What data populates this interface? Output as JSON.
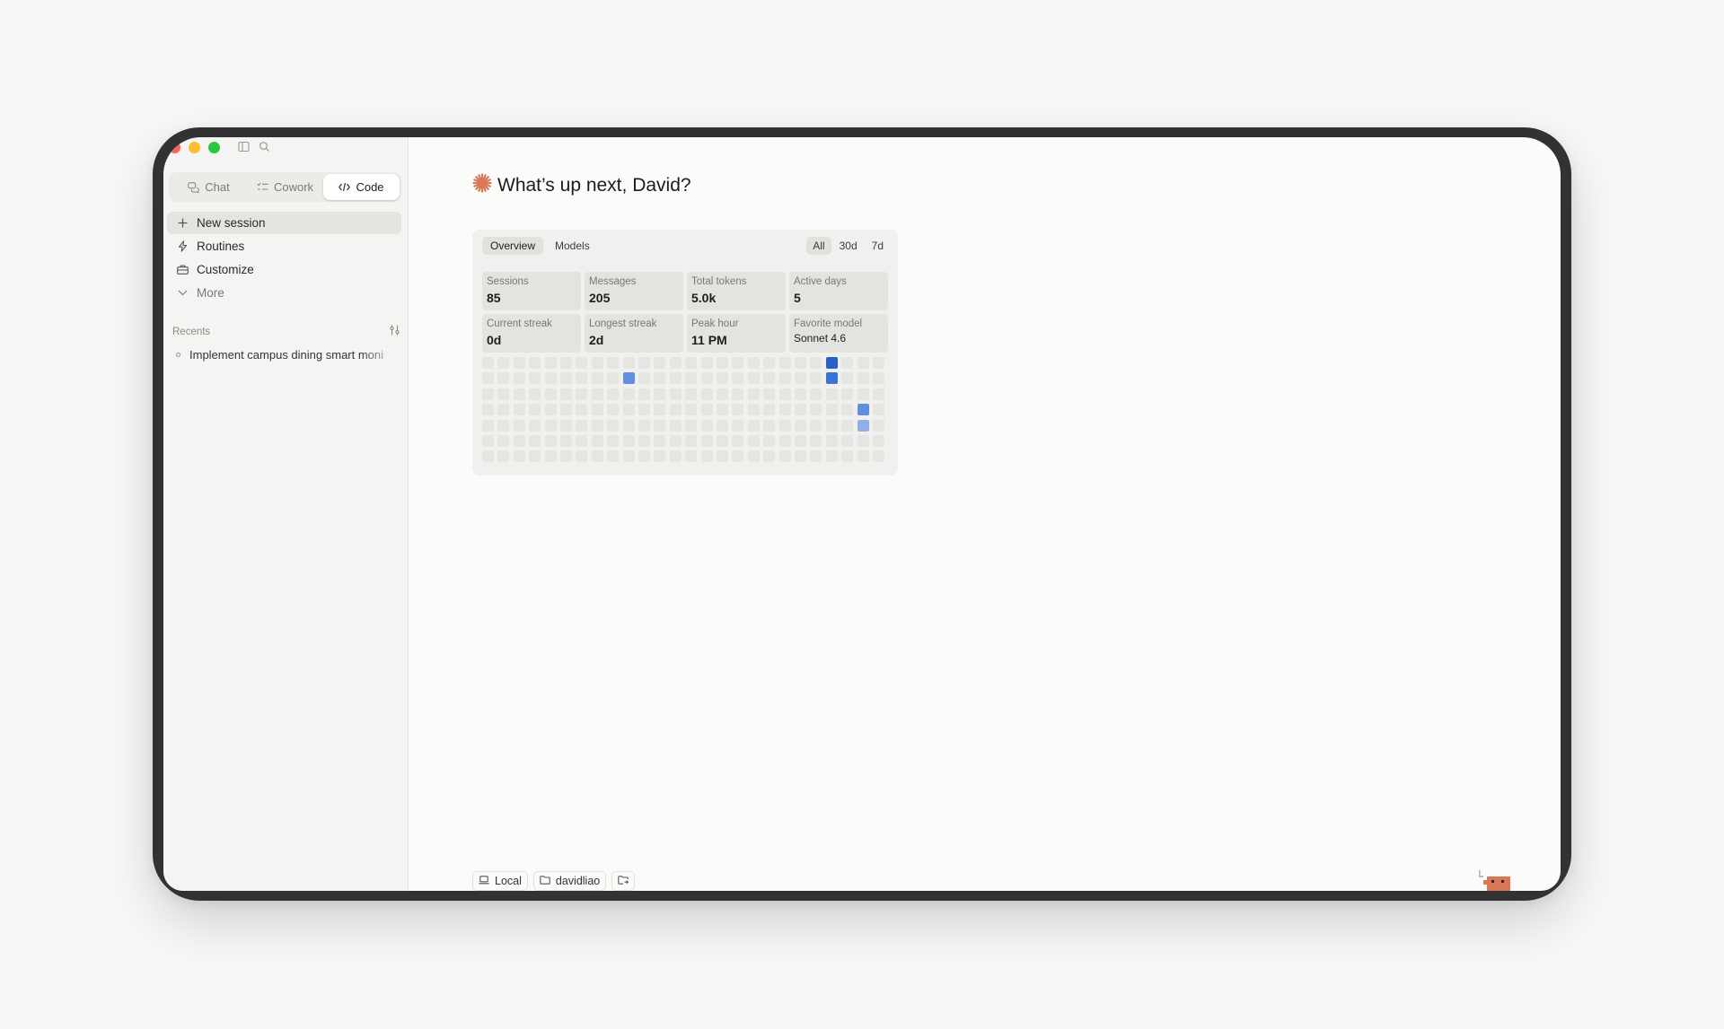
{
  "window": {
    "controls": [
      "close",
      "minimize",
      "maximize"
    ],
    "icons": [
      "sidebar-toggle-icon",
      "search-icon"
    ]
  },
  "sidebar": {
    "mode_tabs": [
      {
        "label": "Chat",
        "icon": "chat-bubbles-icon",
        "active": false
      },
      {
        "label": "Cowork",
        "icon": "checklist-icon",
        "active": false
      },
      {
        "label": "Code",
        "icon": "code-brackets-icon",
        "active": true
      }
    ],
    "nav_items": [
      {
        "label": "New session",
        "icon": "plus-icon",
        "active": true
      },
      {
        "label": "Routines",
        "icon": "lightning-icon"
      },
      {
        "label": "Customize",
        "icon": "briefcase-icon"
      },
      {
        "label": "More",
        "icon": "chevron-down-icon"
      }
    ],
    "recents": {
      "heading": "Recents",
      "filter_icon": "sliders-icon",
      "items": [
        {
          "label": "Implement campus dining smart moni"
        }
      ]
    }
  },
  "main": {
    "greeting": "What’s up next, David?",
    "greeting_icon": "sparkle-asterisk-icon",
    "accent_color": "#d97757"
  },
  "stats": {
    "tabs": [
      {
        "label": "Overview",
        "active": true
      },
      {
        "label": "Models",
        "active": false
      }
    ],
    "ranges": [
      {
        "label": "All",
        "active": true
      },
      {
        "label": "30d",
        "active": false
      },
      {
        "label": "7d",
        "active": false
      }
    ],
    "cards": [
      {
        "label": "Sessions",
        "value": "85"
      },
      {
        "label": "Messages",
        "value": "205"
      },
      {
        "label": "Total tokens",
        "value": "5.0k"
      },
      {
        "label": "Active days",
        "value": "5"
      },
      {
        "label": "Current streak",
        "value": "0d"
      },
      {
        "label": "Longest streak",
        "value": "2d"
      },
      {
        "label": "Peak hour",
        "value": "11 PM"
      },
      {
        "label": "Favorite model",
        "value": "Sonnet 4.6"
      }
    ],
    "heatmap": {
      "weeks": 26,
      "days": 7,
      "empty_color": "#e5e5e2",
      "levels": [
        "#e5e5e2",
        "#8fb0e8",
        "#5f8fde",
        "#3a73d6",
        "#2a60c8"
      ],
      "active": [
        {
          "week": 9,
          "day": 1,
          "level": 2
        },
        {
          "week": 22,
          "day": 0,
          "level": 4
        },
        {
          "week": 22,
          "day": 1,
          "level": 3
        },
        {
          "week": 24,
          "day": 3,
          "level": 2
        },
        {
          "week": 24,
          "day": 4,
          "level": 1
        }
      ],
      "last_week_days": 6
    }
  },
  "footer": {
    "chips": [
      {
        "label": "Local",
        "icon": "laptop-icon"
      },
      {
        "label": "davidliao",
        "icon": "folder-icon"
      },
      {
        "label": "",
        "icon": "folder-arrow-icon"
      }
    ],
    "mascot_icon": "pixel-mascot-icon"
  }
}
